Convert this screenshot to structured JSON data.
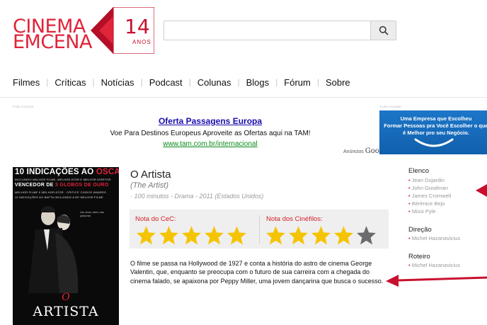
{
  "logo": {
    "line1": "CINEMA",
    "line2": "EMCENA",
    "years": "14",
    "years_label": "ANOS"
  },
  "search": {
    "value": "",
    "placeholder": "",
    "icon": "search-icon"
  },
  "nav": {
    "items": [
      "Filmes",
      "Críticas",
      "Notícias",
      "Podcast",
      "Colunas",
      "Blogs",
      "Fórum",
      "Sobre"
    ]
  },
  "ads": {
    "publicidade_label": "PUBLICIDADE",
    "text_ad": {
      "title": "Oferta Passagens Europa",
      "text": "Voe Para Destinos Europeus Aproveite as Ofertas aqui na TAM!",
      "url": "www.tam.com.br/internacional",
      "anuncios": "Anúncios",
      "google": "Google"
    },
    "banner": {
      "line1": "Uma Empresa que Escolheu",
      "line2": "Formar Pessoas pra Você Escolher o que",
      "line3": "é Melhor pro seu Negócio."
    }
  },
  "poster": {
    "headline_pre": "10 INDICAÇÕES AO ",
    "headline_oscar": "OSCAR",
    "line2": "INCLUINDO MELHOR FILME, MELHOR ATOR E MELHOR DIRETOR",
    "line3_pre": "VENCEDOR DE ",
    "line3_red": "3 GLOBOS DE OURO",
    "line4": "MELHOR FILME E MELHOR ATOR · CRITICS' CHOICE AWARDS",
    "line5": "12 INDICAÇÕES AO BAFTA INCLUINDO A DE MELHOR FILME",
    "tagline": "Um amor além das palavras",
    "o": "O",
    "title": "ARTISTA"
  },
  "movie": {
    "title": "O Artista",
    "original_title": "(The Artist)",
    "meta": "· 100 minutos - Drama - 2011 (Estados Unidos)",
    "synopsis": "O filme se passa na Hollywood de 1927 e conta a história do astro de cinema George Valentin, que, enquanto se preocupa com o futuro de sua carreira com a chegada do cinema falado, se apaixona por Peppy Miller, uma jovem dançarina que busca o sucesso."
  },
  "ratings": {
    "cec_label": "Nota do CeC:",
    "cec_stars": 5,
    "cinefilos_label": "Nota dos Cinéfilos:",
    "cinefilos_stars": 4,
    "max_stars": 5,
    "star_color": "#f5c400",
    "empty_star_color": "#6b6b6b"
  },
  "credits": {
    "elenco_label": "Elenco",
    "elenco": [
      "Jean Dujardin",
      "John Goodman",
      "James Cromwell",
      "Bérénice Bejo",
      "Missi Pyle"
    ],
    "direcao_label": "Direção",
    "direcao": [
      "Michel Hazanavicius"
    ],
    "roteiro_label": "Roteiro",
    "roteiro": [
      "Michel Hazanavicius"
    ]
  },
  "colors": {
    "brand_red": "#e0243a",
    "accent_red": "#d2232a",
    "arrow": "#c8102e"
  }
}
